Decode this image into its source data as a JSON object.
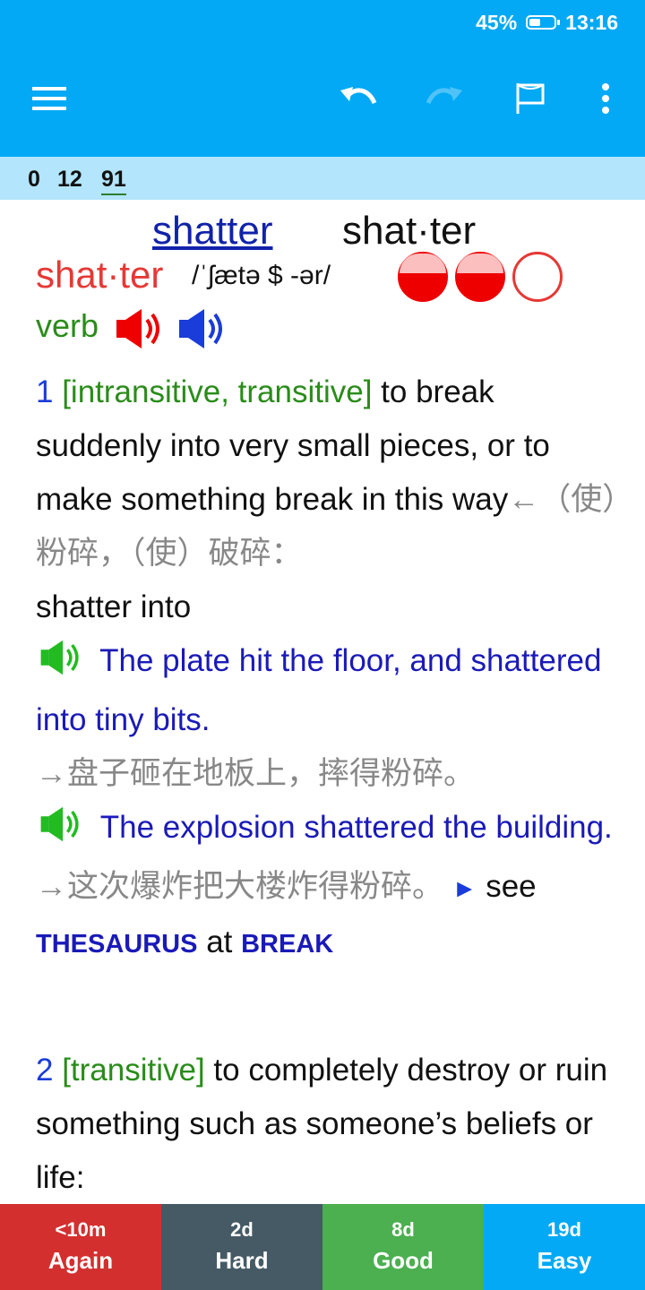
{
  "status": {
    "battery": "45%",
    "battery_level": 0.45,
    "time": "13:16"
  },
  "toolbar": {
    "menu_icon": "hamburger-icon",
    "undo_icon": "undo-icon",
    "redo_icon": "redo-icon",
    "flag_icon": "flag-icon",
    "more_icon": "more-vert-icon"
  },
  "counts": {
    "new": "0",
    "learning": "12",
    "review": "91"
  },
  "entry": {
    "headword_link": "shatter",
    "headword": "shat·ter",
    "hw_red": "shat·ter",
    "pronunciation": "/ˈʃætə $ -ər/",
    "frequency": [
      "full",
      "full",
      "empty"
    ],
    "pos": "verb",
    "speaker_uk": "speaker-red-icon",
    "speaker_us": "speaker-blue-icon"
  },
  "sense1": {
    "num": "1",
    "gram": "[intransitive, transitive]",
    "def": " to break suddenly into very small pieces, or to make something break in this way",
    "zh": "←（使）粉碎，（使）破碎：",
    "collocation": "shatter into",
    "ex1": "The plate hit the floor, and shattered into tiny bits.",
    "ex1_zh": "→盘子砸在地板上，摔得粉碎。",
    "ex2": "The explosion shattered the building.",
    "ex2_zh": "→这次爆炸把大楼炸得粉碎。",
    "xref_arrow": "►",
    "xref_see": " see",
    "xref_thes": "THESAURUS",
    "xref_at": " at ",
    "xref_word": "BREAK"
  },
  "sense2": {
    "num": "2",
    "gram": "[transitive]",
    "def": " to completely destroy or ruin something such as someone’s beliefs or life:"
  },
  "review": {
    "again": {
      "ivl": "<10m",
      "label": "Again",
      "color": "#d32f2f"
    },
    "hard": {
      "ivl": "2d",
      "label": "Hard",
      "color": "#455a64"
    },
    "good": {
      "ivl": "8d",
      "label": "Good",
      "color": "#4caf50"
    },
    "easy": {
      "ivl": "19d",
      "label": "Easy",
      "color": "#03a9f4"
    }
  }
}
